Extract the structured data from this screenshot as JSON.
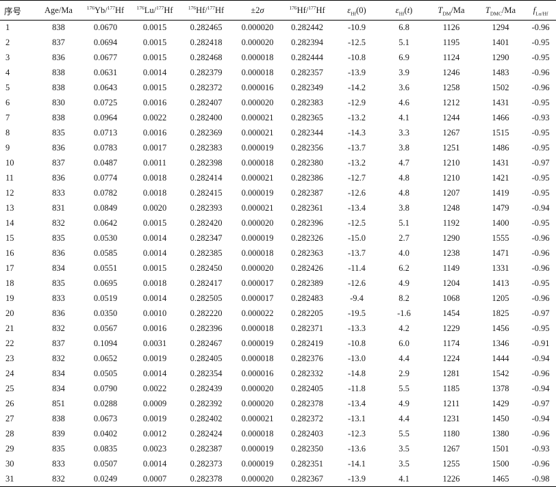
{
  "headers": {
    "seq": "序号",
    "age": "Age/Ma",
    "yb_sup": "176",
    "yb_a": "Yb/",
    "yb_sup2": "177",
    "yb_b": "Hf",
    "lu_sup": "176",
    "lu_a": "Lu/",
    "lu_sup2": "177",
    "lu_b": "Hf",
    "hf_sup": "176",
    "hf_a": "Hf/",
    "hf_sup2": "177",
    "hf_b": "Hf",
    "sigma_a": "±2",
    "sigma_b": "σ",
    "hfi_sup": "176",
    "hfi_a": "Hf/",
    "hfi_sup2": "177",
    "hfi_b": "Hf",
    "e0_a": "ε",
    "e0_sub": "Hf",
    "e0_b": "(0)",
    "et_a": "ε",
    "et_sub": "Hf",
    "et_b": "(",
    "et_c": "t",
    "et_d": ")",
    "tdm_a": "T",
    "tdm_sub": "DM",
    "tdm_b": "/Ma",
    "tdmc_a": "T",
    "tdmc_sub": "DMC",
    "tdmc_b": "/Ma",
    "f_a": "f",
    "f_sub": "Lu/Hf"
  },
  "rows": [
    [
      "1",
      "838",
      "0.0670",
      "0.0015",
      "0.282465",
      "0.000020",
      "0.282442",
      "-10.9",
      "6.8",
      "1126",
      "1294",
      "-0.96"
    ],
    [
      "2",
      "837",
      "0.0694",
      "0.0015",
      "0.282418",
      "0.000020",
      "0.282394",
      "-12.5",
      "5.1",
      "1195",
      "1401",
      "-0.95"
    ],
    [
      "3",
      "836",
      "0.0677",
      "0.0015",
      "0.282468",
      "0.000018",
      "0.282444",
      "-10.8",
      "6.9",
      "1124",
      "1290",
      "-0.95"
    ],
    [
      "4",
      "838",
      "0.0631",
      "0.0014",
      "0.282379",
      "0.000018",
      "0.282357",
      "-13.9",
      "3.9",
      "1246",
      "1483",
      "-0.96"
    ],
    [
      "5",
      "838",
      "0.0643",
      "0.0015",
      "0.282372",
      "0.000016",
      "0.282349",
      "-14.2",
      "3.6",
      "1258",
      "1502",
      "-0.96"
    ],
    [
      "6",
      "830",
      "0.0725",
      "0.0016",
      "0.282407",
      "0.000020",
      "0.282383",
      "-12.9",
      "4.6",
      "1212",
      "1431",
      "-0.95"
    ],
    [
      "7",
      "838",
      "0.0964",
      "0.0022",
      "0.282400",
      "0.000021",
      "0.282365",
      "-13.2",
      "4.1",
      "1244",
      "1466",
      "-0.93"
    ],
    [
      "8",
      "835",
      "0.0713",
      "0.0016",
      "0.282369",
      "0.000021",
      "0.282344",
      "-14.3",
      "3.3",
      "1267",
      "1515",
      "-0.95"
    ],
    [
      "9",
      "836",
      "0.0783",
      "0.0017",
      "0.282383",
      "0.000019",
      "0.282356",
      "-13.7",
      "3.8",
      "1251",
      "1486",
      "-0.95"
    ],
    [
      "10",
      "837",
      "0.0487",
      "0.0011",
      "0.282398",
      "0.000018",
      "0.282380",
      "-13.2",
      "4.7",
      "1210",
      "1431",
      "-0.97"
    ],
    [
      "11",
      "836",
      "0.0774",
      "0.0018",
      "0.282414",
      "0.000021",
      "0.282386",
      "-12.7",
      "4.8",
      "1210",
      "1421",
      "-0.95"
    ],
    [
      "12",
      "833",
      "0.0782",
      "0.0018",
      "0.282415",
      "0.000019",
      "0.282387",
      "-12.6",
      "4.8",
      "1207",
      "1419",
      "-0.95"
    ],
    [
      "13",
      "831",
      "0.0849",
      "0.0020",
      "0.282393",
      "0.000021",
      "0.282361",
      "-13.4",
      "3.8",
      "1248",
      "1479",
      "-0.94"
    ],
    [
      "14",
      "832",
      "0.0642",
      "0.0015",
      "0.282420",
      "0.000020",
      "0.282396",
      "-12.5",
      "5.1",
      "1192",
      "1400",
      "-0.95"
    ],
    [
      "15",
      "835",
      "0.0530",
      "0.0014",
      "0.282347",
      "0.000019",
      "0.282326",
      "-15.0",
      "2.7",
      "1290",
      "1555",
      "-0.96"
    ],
    [
      "16",
      "836",
      "0.0585",
      "0.0014",
      "0.282385",
      "0.000018",
      "0.282363",
      "-13.7",
      "4.0",
      "1238",
      "1471",
      "-0.96"
    ],
    [
      "17",
      "834",
      "0.0551",
      "0.0015",
      "0.282450",
      "0.000020",
      "0.282426",
      "-11.4",
      "6.2",
      "1149",
      "1331",
      "-0.96"
    ],
    [
      "18",
      "835",
      "0.0695",
      "0.0018",
      "0.282417",
      "0.000017",
      "0.282389",
      "-12.6",
      "4.9",
      "1204",
      "1413",
      "-0.95"
    ],
    [
      "19",
      "833",
      "0.0519",
      "0.0014",
      "0.282505",
      "0.000017",
      "0.282483",
      "-9.4",
      "8.2",
      "1068",
      "1205",
      "-0.96"
    ],
    [
      "20",
      "836",
      "0.0350",
      "0.0010",
      "0.282220",
      "0.000022",
      "0.282205",
      "-19.5",
      "-1.6",
      "1454",
      "1825",
      "-0.97"
    ],
    [
      "21",
      "832",
      "0.0567",
      "0.0016",
      "0.282396",
      "0.000018",
      "0.282371",
      "-13.3",
      "4.2",
      "1229",
      "1456",
      "-0.95"
    ],
    [
      "22",
      "837",
      "0.1094",
      "0.0031",
      "0.282467",
      "0.000019",
      "0.282419",
      "-10.8",
      "6.0",
      "1174",
      "1346",
      "-0.91"
    ],
    [
      "23",
      "832",
      "0.0652",
      "0.0019",
      "0.282405",
      "0.000018",
      "0.282376",
      "-13.0",
      "4.4",
      "1224",
      "1444",
      "-0.94"
    ],
    [
      "24",
      "834",
      "0.0505",
      "0.0014",
      "0.282354",
      "0.000016",
      "0.282332",
      "-14.8",
      "2.9",
      "1281",
      "1542",
      "-0.96"
    ],
    [
      "25",
      "834",
      "0.0790",
      "0.0022",
      "0.282439",
      "0.000020",
      "0.282405",
      "-11.8",
      "5.5",
      "1185",
      "1378",
      "-0.94"
    ],
    [
      "26",
      "851",
      "0.0288",
      "0.0009",
      "0.282392",
      "0.000020",
      "0.282378",
      "-13.4",
      "4.9",
      "1211",
      "1429",
      "-0.97"
    ],
    [
      "27",
      "838",
      "0.0673",
      "0.0019",
      "0.282402",
      "0.000021",
      "0.282372",
      "-13.1",
      "4.4",
      "1231",
      "1450",
      "-0.94"
    ],
    [
      "28",
      "839",
      "0.0402",
      "0.0012",
      "0.282424",
      "0.000018",
      "0.282403",
      "-12.3",
      "5.5",
      "1180",
      "1380",
      "-0.96"
    ],
    [
      "29",
      "835",
      "0.0835",
      "0.0023",
      "0.282387",
      "0.000019",
      "0.282350",
      "-13.6",
      "3.5",
      "1267",
      "1501",
      "-0.93"
    ],
    [
      "30",
      "833",
      "0.0507",
      "0.0014",
      "0.282373",
      "0.000019",
      "0.282351",
      "-14.1",
      "3.5",
      "1255",
      "1500",
      "-0.96"
    ],
    [
      "31",
      "832",
      "0.0249",
      "0.0007",
      "0.282378",
      "0.000020",
      "0.282367",
      "-13.9",
      "4.1",
      "1226",
      "1465",
      "-0.98"
    ]
  ]
}
